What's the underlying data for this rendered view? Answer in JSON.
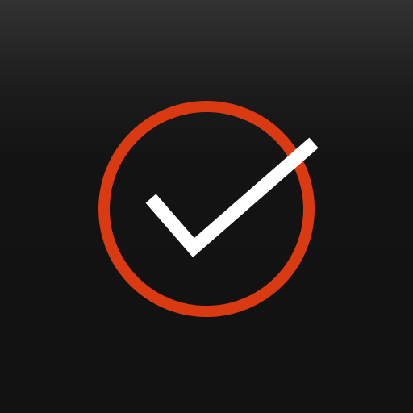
{
  "icon": {
    "name": "checkmark-in-circle-icon",
    "circle_color": "#D93A12",
    "check_color": "#FFFFFF",
    "background_top": "#323232",
    "background_bottom": "#121212"
  }
}
